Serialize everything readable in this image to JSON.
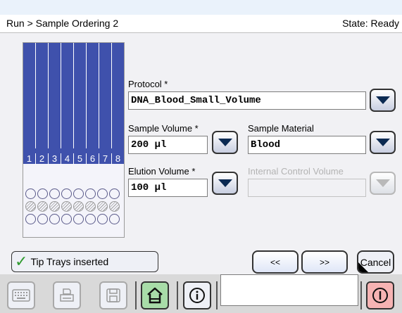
{
  "header": {
    "breadcrumb": "Run > Sample Ordering 2",
    "state": "State: Ready"
  },
  "rack": {
    "positions": [
      "1",
      "2",
      "3",
      "4",
      "5",
      "6",
      "7",
      "8"
    ],
    "strip_color": "#3f51ac"
  },
  "form": {
    "protocol": {
      "label": "Protocol *",
      "value": "DNA_Blood_Small_Volume"
    },
    "sample_volume": {
      "label": "Sample Volume *",
      "value": "200 µl"
    },
    "sample_material": {
      "label": "Sample Material",
      "value": "Blood"
    },
    "elution_volume": {
      "label": "Elution Volume *",
      "value": "100 µl"
    },
    "internal_control_volume": {
      "label": "Internal Control Volume",
      "value": "",
      "enabled": false
    }
  },
  "actions": {
    "tip_trays": {
      "label": "Tip Trays inserted",
      "icon": "checkmark-icon",
      "checked": true
    },
    "prev_label": "<<",
    "next_label": ">>",
    "cancel_label": "Cancel"
  },
  "toolbar": {
    "icons": [
      "keyboard-icon",
      "print-icon",
      "save-icon",
      "home-icon",
      "info-icon",
      "power-icon"
    ],
    "home_color": "#a8dca8",
    "power_color": "#f6b3b3"
  }
}
